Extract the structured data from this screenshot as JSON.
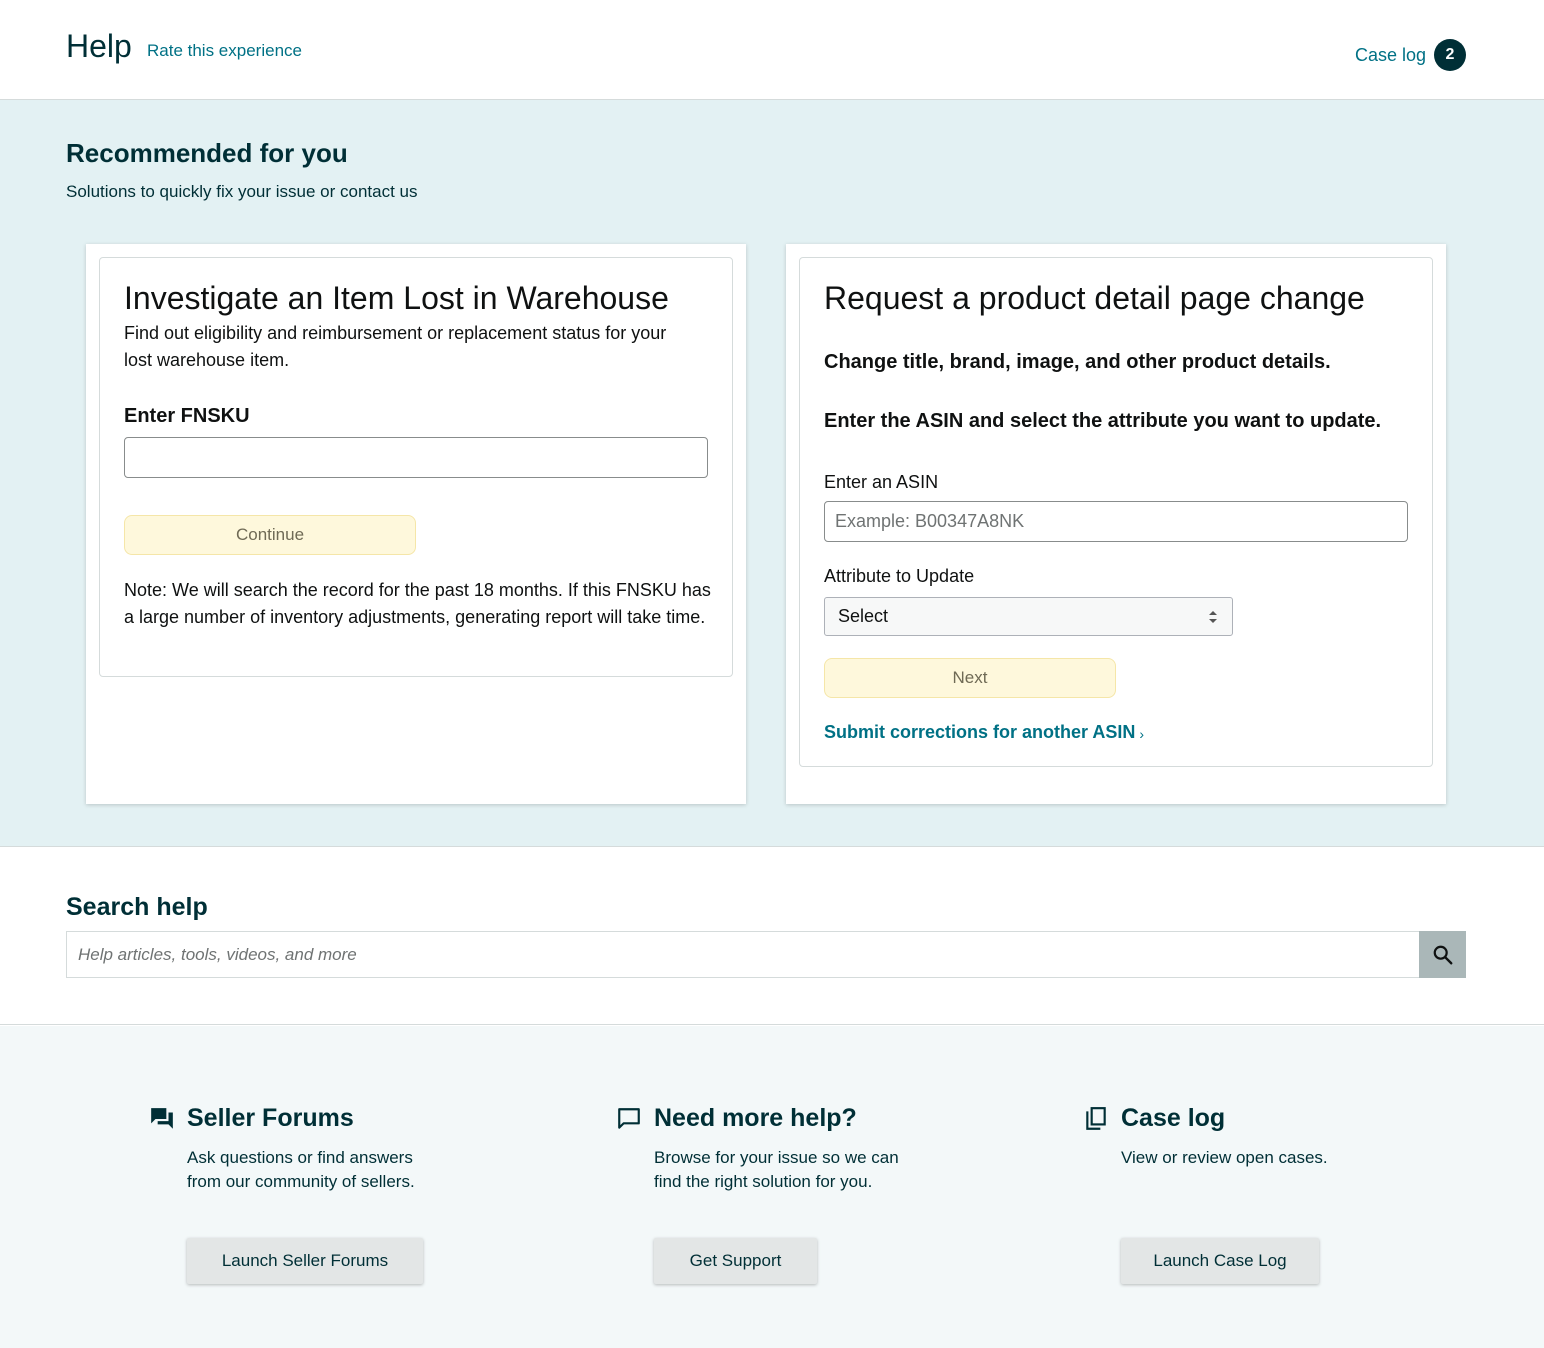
{
  "header": {
    "title": "Help",
    "rate_link": "Rate this experience",
    "case_log_label": "Case log",
    "case_log_count": "2"
  },
  "recommended": {
    "title": "Recommended for you",
    "subtitle": "Solutions to quickly fix your issue or contact us",
    "lost_item_card": {
      "title": "Investigate an Item Lost in Warehouse",
      "description": "Find out eligibility and reimbursement or replacement status for your lost warehouse item.",
      "fnsku_label": "Enter FNSKU",
      "fnsku_value": "",
      "continue_label": "Continue",
      "note": "Note: We will search the record for the past 18 months. If this FNSKU has a large number of inventory adjustments, generating report will take time."
    },
    "detail_page_card": {
      "title": "Request a product detail page change",
      "subtitle": "Change title, brand, image, and other product details.",
      "instruction": "Enter the ASIN and select the attribute you want to update.",
      "asin_label": "Enter an ASIN",
      "asin_placeholder": "Example: B00347A8NK",
      "attribute_label": "Attribute to Update",
      "attribute_selected": "Select",
      "next_label": "Next",
      "another_asin_link": "Submit corrections for another ASIN",
      "link_chevron": "›"
    }
  },
  "search": {
    "title": "Search help",
    "placeholder": "Help articles, tools, videos, and more"
  },
  "footer": {
    "seller_forums": {
      "icon": "forum-icon",
      "title": "Seller Forums",
      "description": "Ask questions or find answers from our community of sellers.",
      "button": "Launch Seller Forums"
    },
    "need_help": {
      "icon": "chat-bubble-icon",
      "title": "Need more help?",
      "description": "Browse for your issue so we can find the right solution for you.",
      "button": "Get Support"
    },
    "case_log": {
      "icon": "copy-icon",
      "title": "Case log",
      "description": "View or review open cases.",
      "button": "Launch Case Log"
    }
  },
  "colors": {
    "accent_teal": "#007185",
    "dark_teal": "#002f36",
    "recommended_bg": "#e3f1f3",
    "footer_bg": "#f3f8f9",
    "yellow_button": "#fef8dc"
  }
}
